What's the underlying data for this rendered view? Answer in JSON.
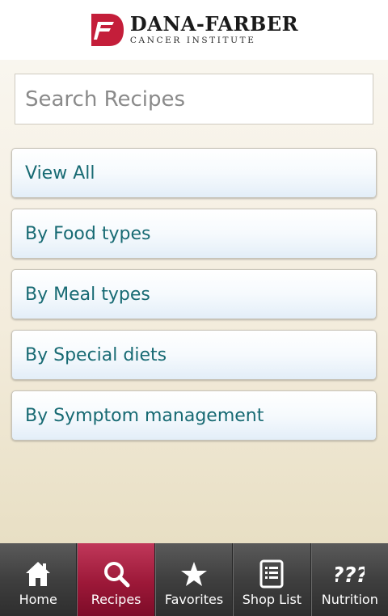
{
  "header": {
    "logo_title": "DANA-FARBER",
    "logo_subtitle": "CANCER INSTITUTE",
    "brand_color": "#c41e3a"
  },
  "search": {
    "placeholder": "Search Recipes",
    "value": ""
  },
  "menu": [
    {
      "label": "View All"
    },
    {
      "label": "By Food types"
    },
    {
      "label": "By Meal types"
    },
    {
      "label": "By Special diets"
    },
    {
      "label": "By Symptom management"
    }
  ],
  "tabs": [
    {
      "label": "Home",
      "icon": "home-icon",
      "active": false
    },
    {
      "label": "Recipes",
      "icon": "search-icon",
      "active": true
    },
    {
      "label": "Favorites",
      "icon": "star-icon",
      "active": false
    },
    {
      "label": "Shop List",
      "icon": "list-icon",
      "active": false
    },
    {
      "label": "Nutrition",
      "icon": "question-marks-icon",
      "active": false
    }
  ],
  "colors": {
    "menu_text": "#176a73",
    "active_tab": "#9c1838"
  }
}
